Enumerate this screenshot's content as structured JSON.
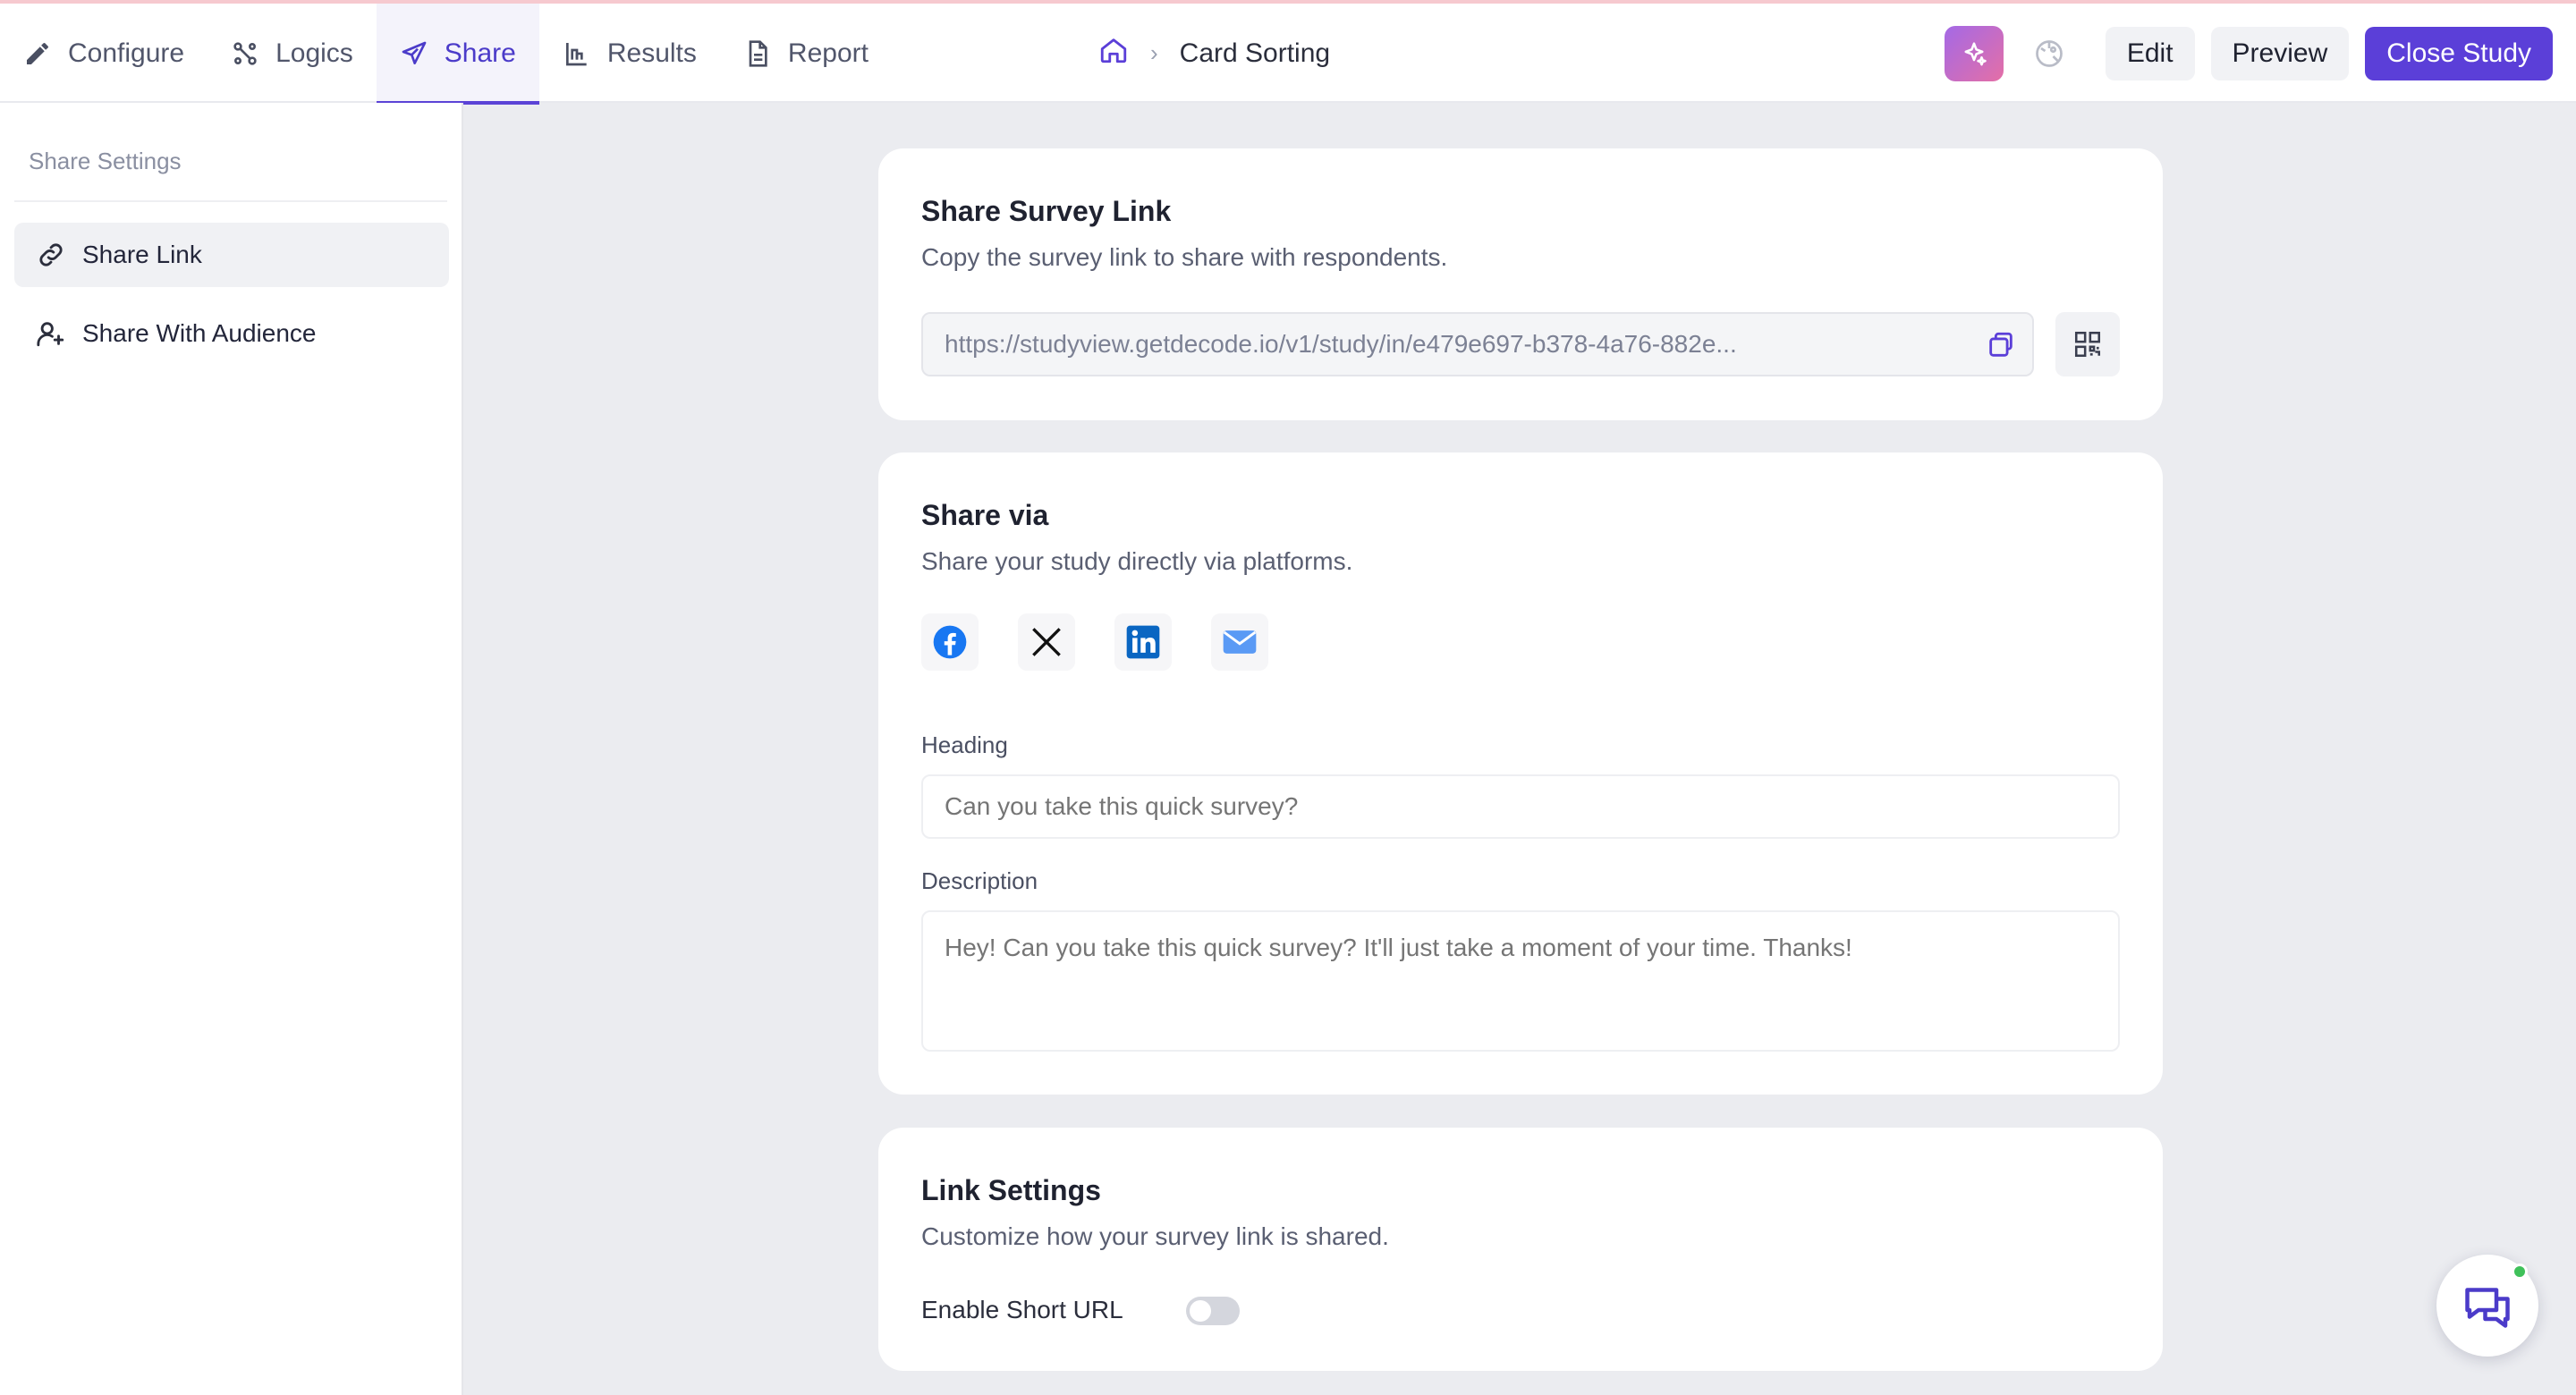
{
  "nav": {
    "tabs": [
      {
        "label": "Configure",
        "icon": "pencil-icon"
      },
      {
        "label": "Logics",
        "icon": "logic-icon"
      },
      {
        "label": "Share",
        "icon": "send-icon",
        "active": true
      },
      {
        "label": "Results",
        "icon": "results-icon"
      },
      {
        "label": "Report",
        "icon": "document-icon"
      }
    ]
  },
  "breadcrumb": {
    "home_icon": "home-icon",
    "current": "Card Sorting"
  },
  "actions": {
    "ai_icon": "sparkle-icon",
    "theme_icon": "palette-icon",
    "edit": "Edit",
    "preview": "Preview",
    "close": "Close Study"
  },
  "sidebar": {
    "title": "Share Settings",
    "items": [
      {
        "label": "Share Link",
        "icon": "link-icon",
        "active": true
      },
      {
        "label": "Share With Audience",
        "icon": "user-plus-icon",
        "active": false
      }
    ]
  },
  "share_link": {
    "title": "Share Survey Link",
    "subtitle": "Copy the survey link to share with respondents.",
    "url": "https://studyview.getdecode.io/v1/study/in/e479e697-b378-4a76-882e..."
  },
  "share_via": {
    "title": "Share via",
    "subtitle": "Share your study directly via platforms.",
    "platforms": [
      "facebook-icon",
      "x-icon",
      "linkedin-icon",
      "email-icon"
    ],
    "heading_label": "Heading",
    "heading_placeholder": "Can you take this quick survey?",
    "description_label": "Description",
    "description_placeholder": "Hey! Can you take this quick survey? It'll just take a moment of your time. Thanks!"
  },
  "link_settings": {
    "title": "Link Settings",
    "subtitle": "Customize how your survey link is shared.",
    "short_url_label": "Enable Short URL",
    "short_url_enabled": false
  },
  "colors": {
    "accent": "#5b3fd8",
    "page_bg": "#ebecf0",
    "online": "#3fc15a"
  }
}
